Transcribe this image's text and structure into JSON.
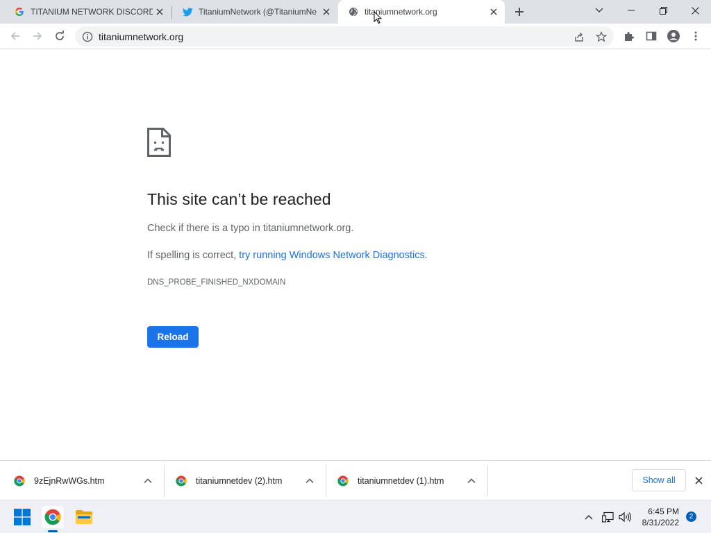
{
  "browser": {
    "tabs": [
      {
        "title": "TITANIUM NETWORK DISCORD - ",
        "favicon": "google-icon"
      },
      {
        "title": "TitaniumNetwork (@TitaniumNe",
        "favicon": "twitter-icon"
      },
      {
        "title": "titaniumnetwork.org",
        "favicon": "globe-icon",
        "active": true
      }
    ],
    "address": "titaniumnetwork.org"
  },
  "error_page": {
    "title": "This site can’t be reached",
    "line1": "Check if there is a typo in titaniumnetwork.org.",
    "line2_prefix": "If spelling is correct, ",
    "line2_link": "try running Windows Network Diagnostics",
    "line2_suffix": ".",
    "error_code": "DNS_PROBE_FINISHED_NXDOMAIN",
    "reload_label": "Reload"
  },
  "downloads": {
    "items": [
      {
        "name": "9zEjnRwWGs.htm"
      },
      {
        "name": "titaniumnetdev (2).htm"
      },
      {
        "name": "titaniumnetdev (1).htm"
      }
    ],
    "show_all_label": "Show all"
  },
  "taskbar": {
    "time": "6:45 PM",
    "date": "8/31/2022",
    "notification_count": "2"
  },
  "colors": {
    "accent": "#1a73e8",
    "tabstrip": "#dee1e6",
    "windows_accent": "#005fb8"
  }
}
